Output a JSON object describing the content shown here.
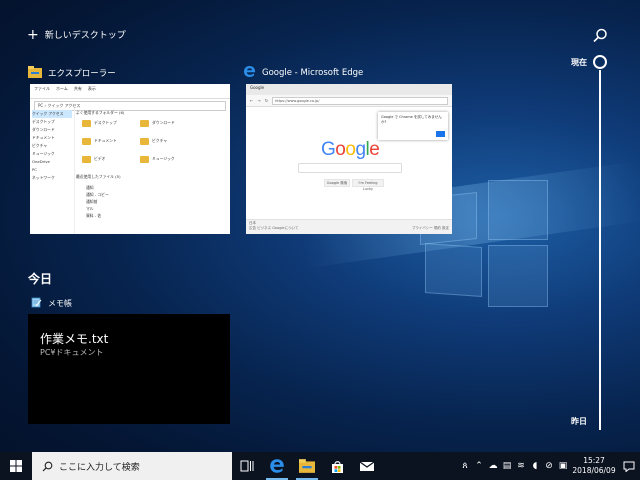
{
  "new_desktop": {
    "label": "新しいデスクトップ"
  },
  "windows": [
    {
      "title": "エクスプローラー",
      "icon": "file-explorer-icon",
      "breadcrumb": "PC › クイック アクセス",
      "ribbon_tabs": [
        "ファイル",
        "ホーム",
        "共有",
        "表示"
      ],
      "nav_items": [
        "クイック アクセス",
        "デスクトップ",
        "ダウンロード",
        "ドキュメント",
        "ピクチャ",
        "ミュージック",
        "OneDrive",
        "PC",
        "ネットワーク"
      ],
      "section_frequent": "よく使用するフォルダー (6)",
      "folders": [
        "デスクトップ",
        "ダウンロード",
        "ドキュメント",
        "ピクチャ",
        "ビデオ",
        "ミュージック"
      ],
      "section_recent": "最近使用したファイル (5)",
      "recent_files": [
        "通知",
        "通知 - コピー",
        "通知前",
        "マル",
        "資料 - 佐"
      ]
    },
    {
      "title": "Google - Microsoft Edge",
      "icon": "edge-icon",
      "tab_label": "Google",
      "url": "https://www.google.co.jp/",
      "logo_text": "Google",
      "buttons": [
        "Google 検索",
        "I'm Feeling Lucky"
      ],
      "popup_text": "Google で Chrome を試してみませんか?",
      "footer_left": "日本",
      "footer_links": "広告  ビジネス  Googleについて",
      "footer_right": "プライバシー  規約  設定"
    }
  ],
  "timeline": {
    "section_label": "今日",
    "app_name": "メモ帳",
    "card_title": "作業メモ.txt",
    "card_subtitle": "PC¥ドキュメント",
    "now_label": "現在",
    "yesterday_label": "昨日"
  },
  "taskbar": {
    "search_placeholder": "ここに入力して検索",
    "pinned": [
      "task-view-icon",
      "edge-icon",
      "file-explorer-icon",
      "store-icon",
      "mail-icon"
    ],
    "time": "15:27",
    "date": "2018/06/09"
  },
  "colors": {
    "accent": "#0078d7",
    "taskbar": "#0b1220",
    "folder": "#e8b73a"
  }
}
